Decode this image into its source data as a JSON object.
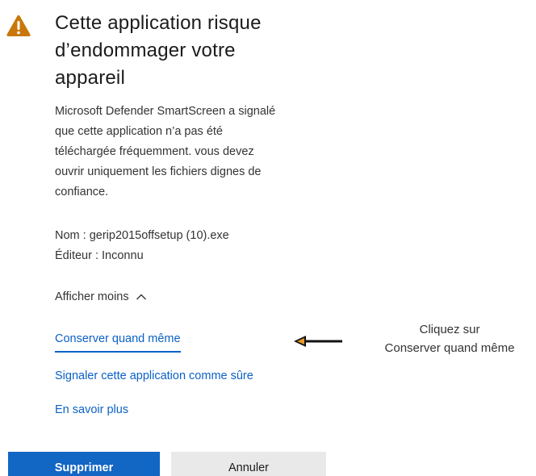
{
  "dialog": {
    "title_line1": "Cette application risque",
    "title_line2": "d’endommager votre",
    "title_line3": "appareil",
    "description_line1": "Microsoft Defender SmartScreen a signalé",
    "description_line2": "que cette application n’a pas été",
    "description_line3": "téléchargée fréquemment. vous devez",
    "description_line4": "ouvrir uniquement les fichiers dignes de",
    "description_line5": "confiance.",
    "file_name": "Nom : gerip2015offsetup (10).exe",
    "publisher": "Éditeur : Inconnu",
    "toggle_label": "Afficher moins",
    "links": {
      "keep_anyway": "Conserver quand même",
      "report_safe": "Signaler cette application comme sûre",
      "learn_more": "En savoir plus"
    },
    "buttons": {
      "delete": "Supprimer",
      "cancel": "Annuler"
    }
  },
  "annotation": {
    "line1": "Cliquez sur",
    "line2": "Conserver quand même"
  },
  "icons": {
    "warning": "warning-triangle-icon",
    "toggle": "chevron-up-icon",
    "pointer": "arrow-left-icon"
  },
  "colors": {
    "warning": "#c8780a",
    "link": "#0b61c7",
    "primary_button": "#1266c4",
    "secondary_button": "#e9e9e9",
    "arrow_tip": "#e79a2b"
  }
}
